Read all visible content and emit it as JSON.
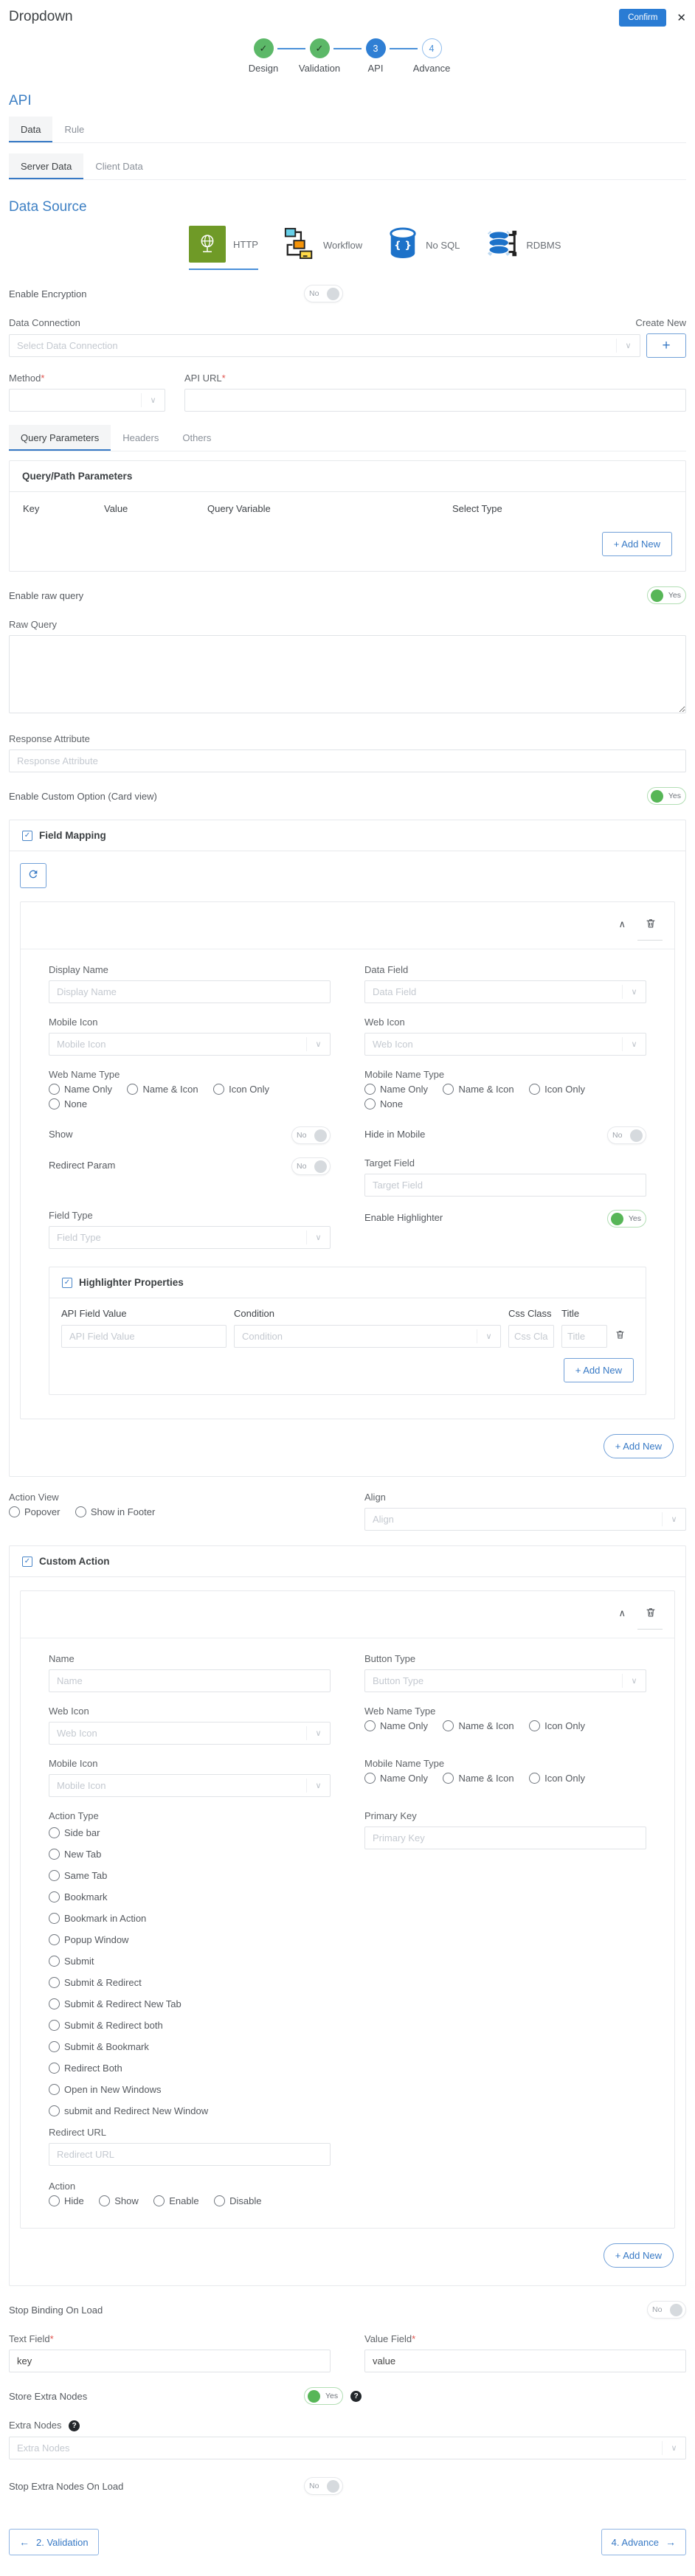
{
  "icons": {
    "close": "✕",
    "check": "✓",
    "chevron_down": "∨",
    "collapse": "∧",
    "plus": "+",
    "help": "?",
    "back_arrow": "←",
    "next_arrow": "→"
  },
  "colors": {
    "accent_blue": "#3779c5",
    "step_green": "#5cb868",
    "toggle_green": "#57b657",
    "http_green": "#6f9a27",
    "db_blue": "#1d72c9"
  },
  "header": {
    "title": "Dropdown",
    "confirm_label": "Confirm"
  },
  "stepper": {
    "steps": [
      {
        "label": "Design",
        "state": "done"
      },
      {
        "label": "Validation",
        "state": "done"
      },
      {
        "label": "API",
        "state": "active",
        "number": "3"
      },
      {
        "label": "Advance",
        "state": "upcoming",
        "number": "4"
      }
    ]
  },
  "api_section": {
    "title": "API"
  },
  "tabs": [
    {
      "label": "Data"
    },
    {
      "label": "Rule"
    }
  ],
  "subtabs": [
    {
      "label": "Server Data"
    },
    {
      "label": "Client Data"
    }
  ],
  "data_source": {
    "title": "Data Source",
    "options": [
      {
        "label": "HTTP"
      },
      {
        "label": "Workflow"
      },
      {
        "label": "No SQL"
      },
      {
        "label": "RDBMS"
      }
    ]
  },
  "form": {
    "required_mark": "*",
    "enable_encryption": {
      "label": "Enable Encryption",
      "value": "No"
    },
    "data_connection": {
      "label": "Data Connection",
      "create_new": "Create New",
      "placeholder": "Select Data Connection"
    },
    "method": {
      "label": "Method"
    },
    "api_url": {
      "label": "API URL"
    },
    "param_tabs": [
      {
        "label": "Query Parameters"
      },
      {
        "label": "Headers"
      },
      {
        "label": "Others"
      }
    ],
    "query_params": {
      "title": "Query/Path Parameters",
      "columns": [
        "Key",
        "Value",
        "Query Variable",
        "Select Type"
      ],
      "add_new": "+ Add New"
    },
    "enable_raw_query": {
      "label": "Enable raw query",
      "value": "Yes"
    },
    "raw_query": {
      "label": "Raw Query"
    },
    "response_attribute": {
      "label": "Response Attribute",
      "placeholder": "Response Attribute"
    },
    "enable_custom_option": {
      "label": "Enable Custom Option (Card view)",
      "value": "Yes"
    }
  },
  "field_mapping": {
    "title": "Field Mapping",
    "fields": {
      "display_name": {
        "label": "Display Name",
        "placeholder": "Display Name"
      },
      "data_field": {
        "label": "Data Field",
        "placeholder": "Data Field"
      },
      "mobile_icon": {
        "label": "Mobile Icon",
        "placeholder": "Mobile Icon"
      },
      "web_icon": {
        "label": "Web Icon",
        "placeholder": "Web Icon"
      },
      "web_name_type": {
        "label": "Web Name Type",
        "options": [
          "Name Only",
          "Name & Icon",
          "Icon Only",
          "None"
        ]
      },
      "mobile_name_type": {
        "label": "Mobile Name Type",
        "options": [
          "Name Only",
          "Name & Icon",
          "Icon Only",
          "None"
        ]
      },
      "show": {
        "label": "Show",
        "value": "No"
      },
      "hide_in_mobile": {
        "label": "Hide in Mobile",
        "value": "No"
      },
      "redirect_param": {
        "label": "Redirect Param",
        "value": "No"
      },
      "target_field": {
        "label": "Target Field",
        "placeholder": "Target Field"
      },
      "field_type": {
        "label": "Field Type",
        "placeholder": "Field Type"
      },
      "enable_highlighter": {
        "label": "Enable Highlighter",
        "value": "Yes"
      }
    },
    "highlighter": {
      "title": "Highlighter Properties",
      "columns": [
        "API Field Value",
        "Condition",
        "Css Class",
        "Title"
      ],
      "placeholders": {
        "api_field_value": "API Field Value",
        "condition": "Condition",
        "css_class": "Css Cla",
        "title": "Title"
      },
      "add_new": "+ Add New"
    },
    "add_new": "+ Add New"
  },
  "action_view": {
    "label": "Action View",
    "options": [
      "Popover",
      "Show in Footer"
    ]
  },
  "align": {
    "label": "Align",
    "placeholder": "Align"
  },
  "custom_action": {
    "title": "Custom Action",
    "fields": {
      "name": {
        "label": "Name",
        "placeholder": "Name"
      },
      "button_type": {
        "label": "Button Type",
        "placeholder": "Button Type"
      },
      "web_icon": {
        "label": "Web Icon",
        "placeholder": "Web Icon"
      },
      "web_name_type": {
        "label": "Web Name Type",
        "options": [
          "Name Only",
          "Name & Icon",
          "Icon Only"
        ]
      },
      "mobile_icon": {
        "label": "Mobile Icon",
        "placeholder": "Mobile Icon"
      },
      "mobile_name_type": {
        "label": "Mobile Name Type",
        "options": [
          "Name Only",
          "Name & Icon",
          "Icon Only"
        ]
      },
      "action_type": {
        "label": "Action Type",
        "options": [
          "Side bar",
          "New Tab",
          "Same Tab",
          "Bookmark",
          "Bookmark in Action",
          "Popup Window",
          "Submit",
          "Submit & Redirect",
          "Submit & Redirect New Tab",
          "Submit & Redirect both",
          "Submit & Bookmark",
          "Redirect Both",
          "Open in New Windows",
          "submit and Redirect New Window"
        ]
      },
      "primary_key": {
        "label": "Primary Key",
        "placeholder": "Primary Key"
      },
      "redirect_url": {
        "label": "Redirect URL",
        "placeholder": "Redirect URL"
      },
      "action": {
        "label": "Action",
        "options": [
          "Hide",
          "Show",
          "Enable",
          "Disable"
        ]
      }
    },
    "add_new": "+ Add New"
  },
  "bindings": {
    "stop_binding_on_load": {
      "label": "Stop Binding On Load",
      "value": "No"
    },
    "text_field": {
      "label": "Text Field",
      "value": "key"
    },
    "value_field": {
      "label": "Value Field",
      "value": "value"
    },
    "store_extra_nodes": {
      "label": "Store Extra Nodes",
      "value": "Yes"
    },
    "extra_nodes": {
      "label": "Extra Nodes",
      "placeholder": "Extra Nodes"
    },
    "stop_extra_nodes_on_load": {
      "label": "Stop Extra Nodes On Load",
      "value": "No"
    }
  },
  "footer": {
    "back": "2. Validation",
    "next": "4. Advance"
  }
}
